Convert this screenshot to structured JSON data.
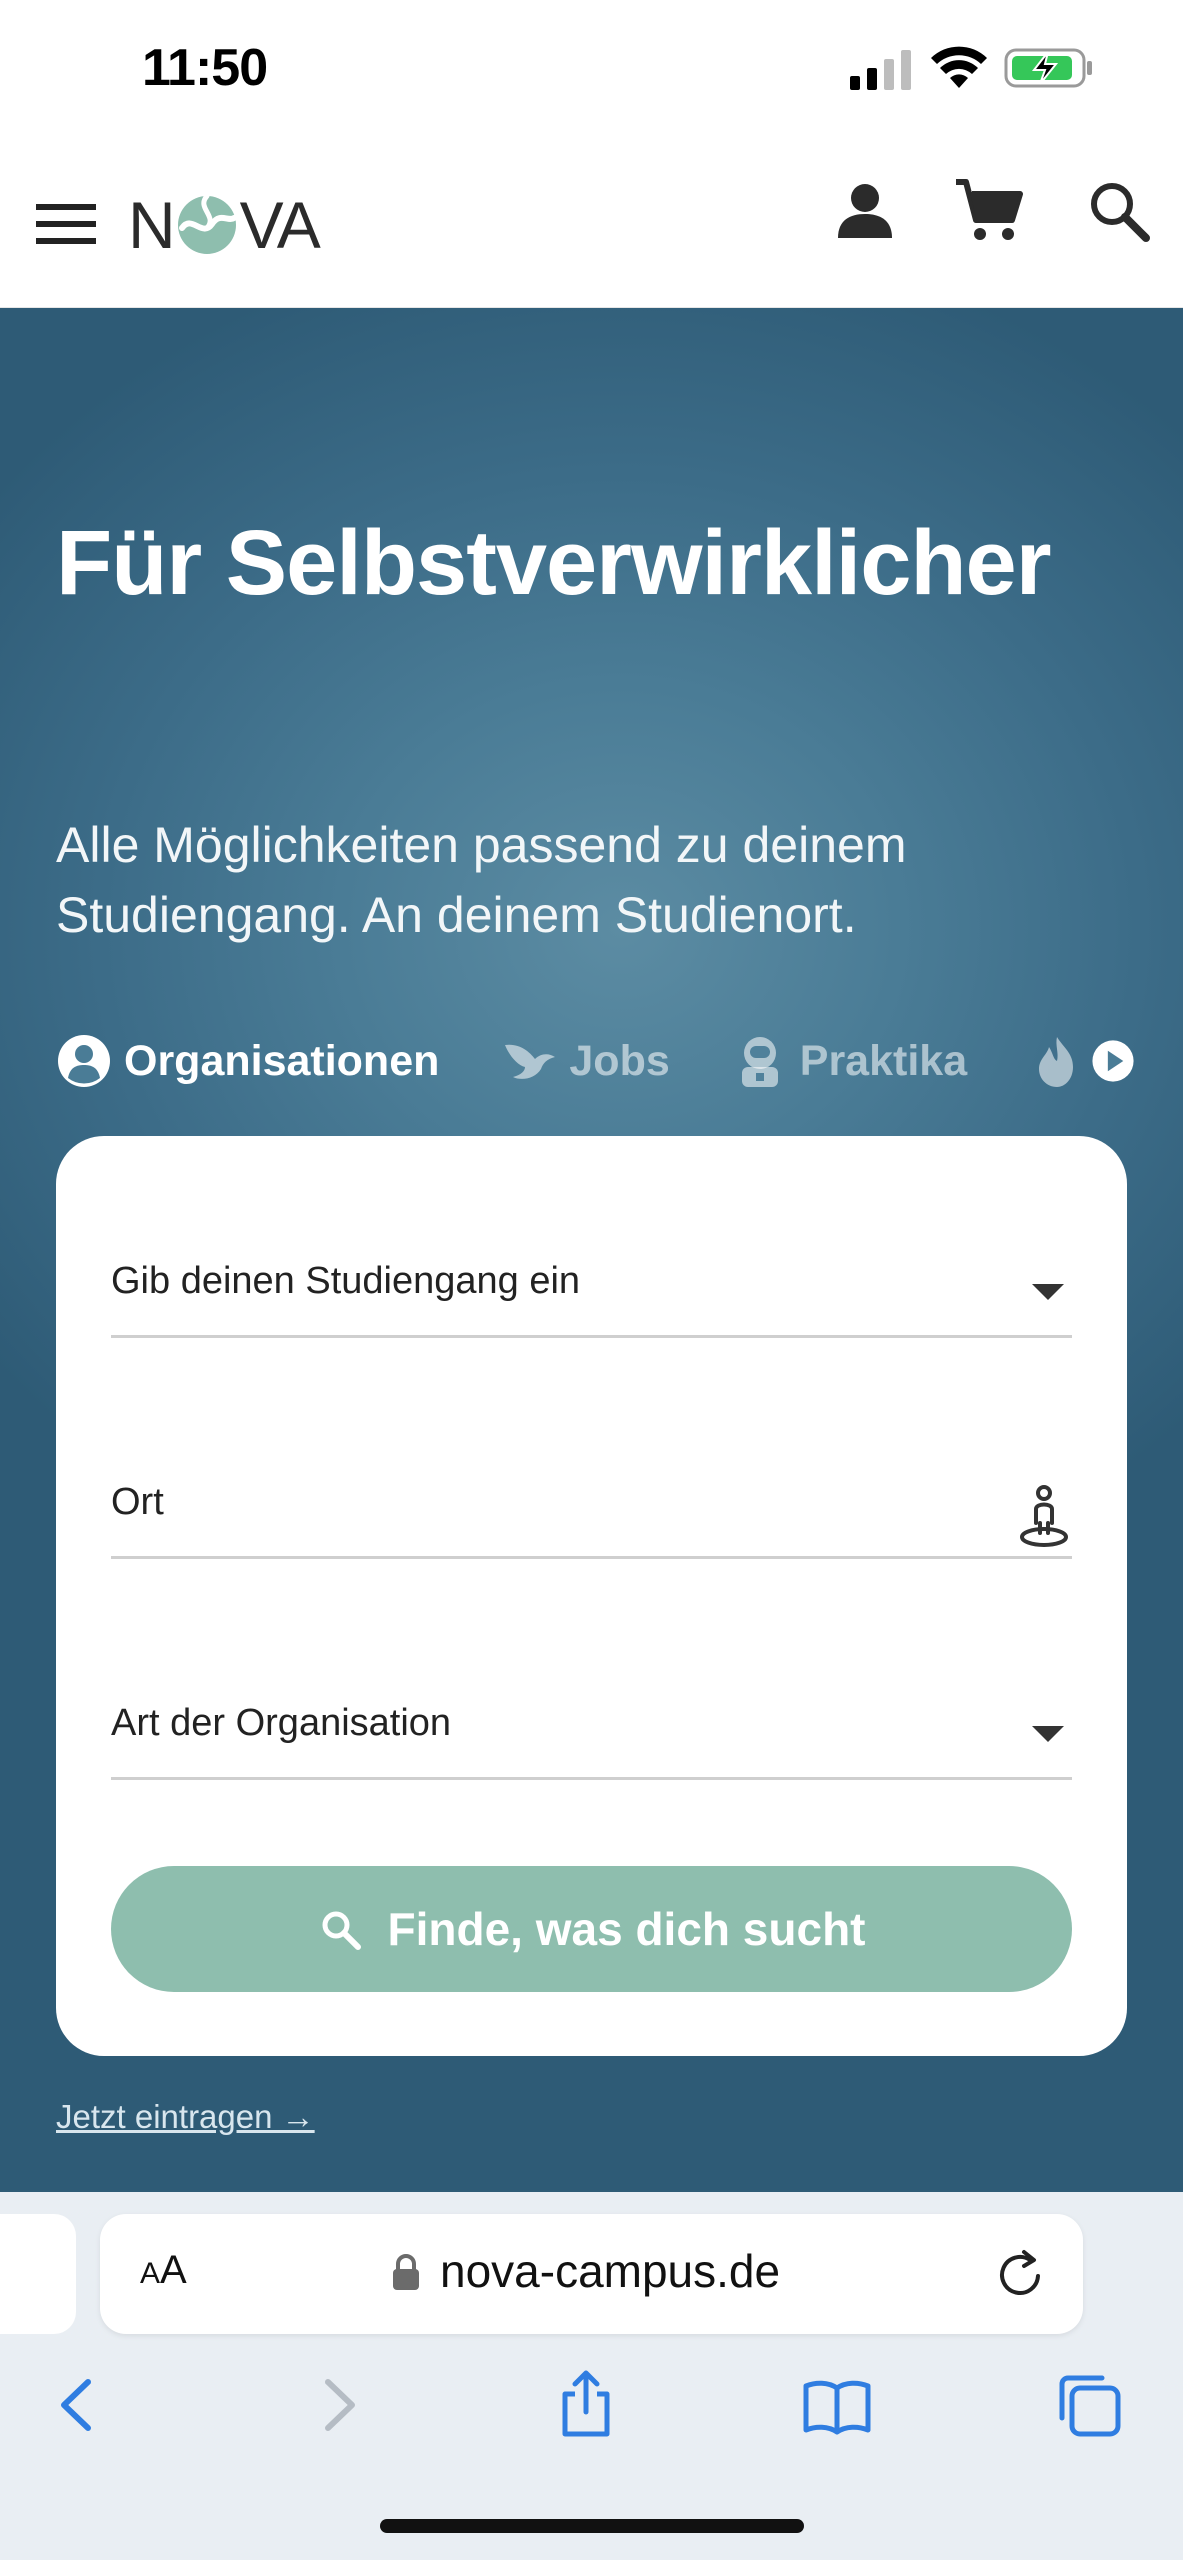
{
  "status_bar": {
    "time": "11:50"
  },
  "header": {
    "logo_left": "N",
    "logo_right": "VA",
    "colors": {
      "logo_mark": "#8ebeae"
    }
  },
  "hero": {
    "title": "Für Selbstverwirklicher",
    "subtitle": "Alle Möglichkeiten passend zu deinem Studiengang. An deinem Studienort.",
    "tabs": [
      {
        "label": "Organisationen",
        "icon": "user-circle-icon",
        "active": true
      },
      {
        "label": "Jobs",
        "icon": "bird-icon",
        "active": false
      },
      {
        "label": "Praktika",
        "icon": "astronaut-icon",
        "active": false
      }
    ]
  },
  "search_card": {
    "study_field": {
      "placeholder": "Gib deinen Studiengang ein"
    },
    "location_field": {
      "placeholder": "Ort"
    },
    "org_type_field": {
      "placeholder": "Art der Organisation"
    },
    "submit_label": "Finde, was dich sucht"
  },
  "register_link": "Jetzt eintragen →",
  "browser": {
    "text_size_label_small": "A",
    "text_size_label_large": "A",
    "url": "nova-campus.de"
  },
  "colors": {
    "hero_bg": "#4a7c96",
    "button": "#8ebeae",
    "browser_accent": "#2f7de1"
  }
}
